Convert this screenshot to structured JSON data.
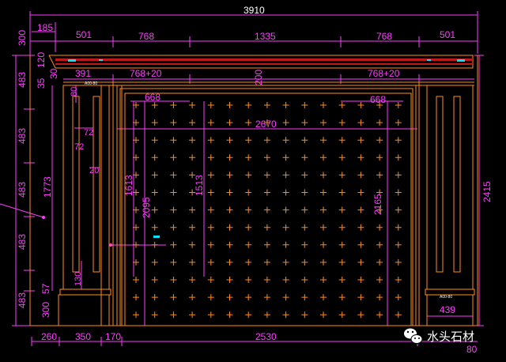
{
  "drawing": {
    "heading_fragment": "",
    "colors": {
      "background": "#000000",
      "outline": "#ff8c1a",
      "dimension": "#ff3cff",
      "cornice": "#c01818",
      "marker": "#00e5ff"
    }
  },
  "dimensions": {
    "overall_width": "3910",
    "overall_height": "2415",
    "top_185": "185",
    "top_501_left": "501",
    "top_768_left": "768",
    "top_1335": "1335",
    "top_768_right": "768",
    "top_501_right": "501",
    "row2_391": "391",
    "row2_768_20_left": "768+20",
    "row2_200": "200",
    "row2_768_20_right": "768+20",
    "inner_668_left": "668",
    "inner_668_right": "668",
    "inner_2670": "2670",
    "left_300_top": "300",
    "left_120": "120",
    "left_30": "30",
    "left_35": "35",
    "left_483_a": "483",
    "left_483_b": "483",
    "left_483_c": "483",
    "left_483_d": "483",
    "left_483_e": "483",
    "left_57": "57",
    "left_300_bottom": "300",
    "left_1773": "1773",
    "col_80": "80",
    "col_72_a": "72",
    "col_72_b": "72",
    "col_20": "20",
    "col_130": "130",
    "v_1613": "1613",
    "v_2095": "2095",
    "v_1513": "1513",
    "v_2165": "2165",
    "bottom_260": "260",
    "bottom_350": "350",
    "bottom_170": "170",
    "bottom_2530": "2530",
    "right_439": "439",
    "right_80": "80"
  },
  "labels": {
    "tag_left_capital": "A00-80",
    "tag_right_base": "A00-80"
  },
  "watermark": {
    "text": "水头石材",
    "icon": "wechat-icon"
  }
}
